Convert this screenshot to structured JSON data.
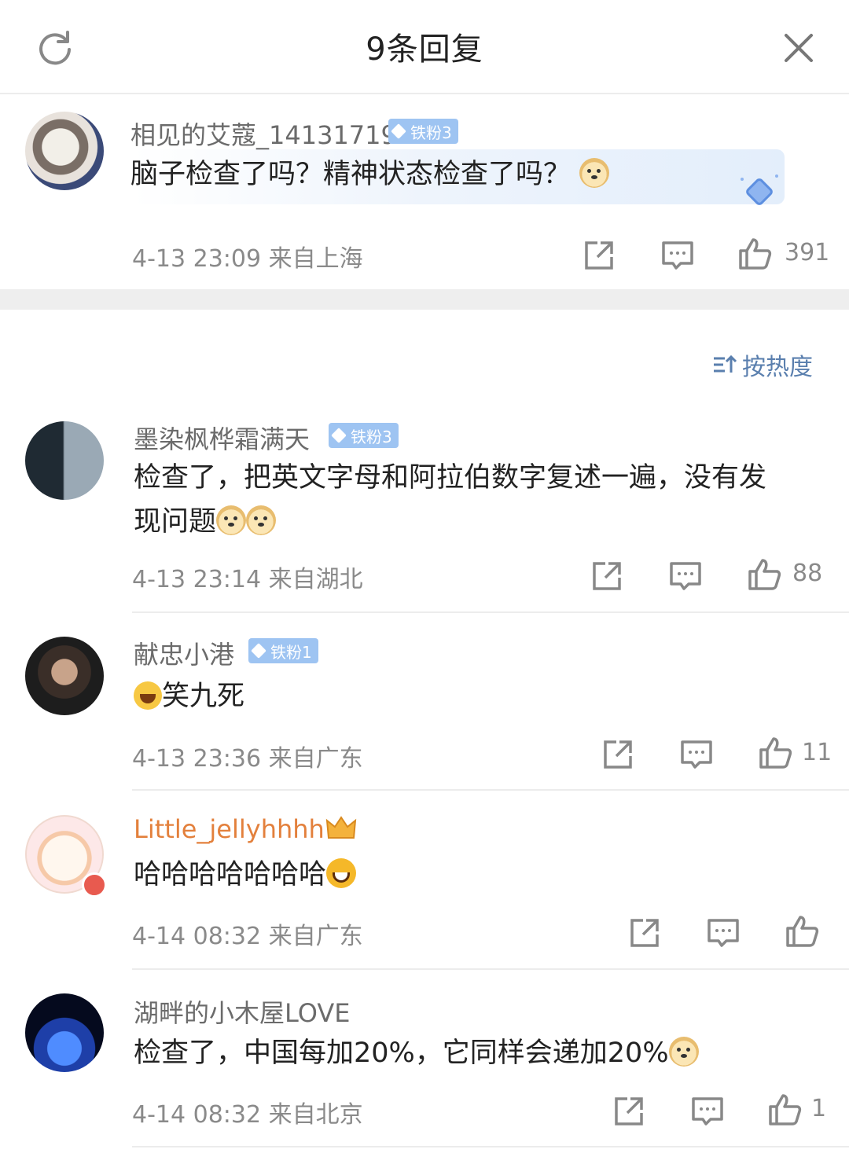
{
  "header": {
    "title": "9条回复"
  },
  "main_comment": {
    "username": "相见的艾蔻_14131719",
    "badge": "铁粉3",
    "text": "脑子检查了吗？精神状态检查了吗？",
    "time": "4-13 23:09",
    "location": "来自上海",
    "likes": "391"
  },
  "sort": {
    "label": "按热度"
  },
  "replies": [
    {
      "username": "墨染枫桦霜满天",
      "badge": "铁粉3",
      "text_line1": "检查了，把英文字母和阿拉伯数字复述一遍，没有发",
      "text_line2": "现问题",
      "time": "4-13 23:14",
      "location": "来自湖北",
      "likes": "88"
    },
    {
      "username": "献忠小港",
      "badge": "铁粉1",
      "text": "笑九死",
      "time": "4-13 23:36",
      "location": "来自广东",
      "likes": "11"
    },
    {
      "username": "Little_jellyhhhh",
      "text": "哈哈哈哈哈哈哈",
      "time": "4-14 08:32",
      "location": "来自广东",
      "likes": ""
    },
    {
      "username": "湖畔的小木屋LOVE",
      "text": "检查了，中国每加20%，它同样会递加20%",
      "time": "4-14 08:32",
      "location": "来自北京",
      "likes": "1"
    }
  ],
  "colors": {
    "accent": "#5a7fae",
    "badge": "#9ec4f2",
    "vip_name": "#e3803c"
  }
}
